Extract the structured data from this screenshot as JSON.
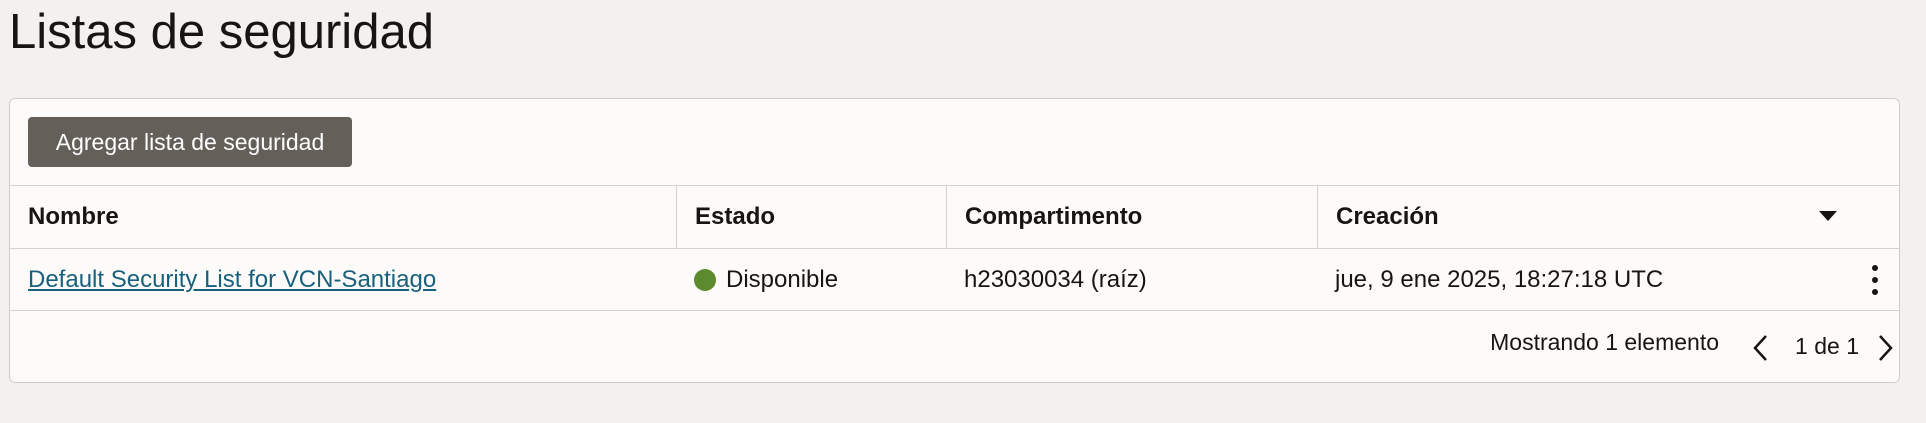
{
  "page": {
    "title": "Listas de seguridad"
  },
  "toolbar": {
    "add_label": "Agregar lista de seguridad"
  },
  "table": {
    "columns": [
      "Nombre",
      "Estado",
      "Compartimento",
      "Creación"
    ],
    "rows": [
      {
        "name": "Default Security List for VCN-Santiago",
        "status": "Disponible",
        "status_color": "#5c8a2e",
        "compartment": "h23030034 (raíz)",
        "created": "jue, 9 ene 2025, 18:27:18 UTC"
      }
    ]
  },
  "footer": {
    "showing": "Mostrando 1 elemento",
    "page_info": "1 de 1"
  },
  "icons": {
    "sort": "chevron-down-icon",
    "row_actions": "kebab-menu-icon",
    "prev": "chevron-left-icon",
    "next": "chevron-right-icon"
  },
  "colors": {
    "button_bg": "#655f5a",
    "link": "#18607c",
    "status_available": "#5c8a2e"
  }
}
